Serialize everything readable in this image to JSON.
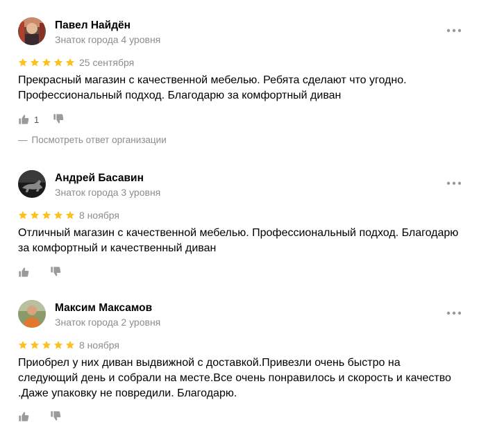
{
  "reviews": [
    {
      "author": "Павел Найдён",
      "level": "Знаток города 4 уровня",
      "rating": 5,
      "date": "25 сентября",
      "text": "Прекрасный магазин с качественной мебелью. Ребята сделают что угодно. Профессиональный подход. Благодарю за комфортный диван",
      "likes": "1",
      "org_answer_link": "Посмотреть ответ организации",
      "avatar_icon": "avatar-photo-icon"
    },
    {
      "author": "Андрей Басавин",
      "level": "Знаток города 3 уровня",
      "rating": 5,
      "date": "8 ноября",
      "text": "Отличный магазин с качественной мебелью. Профессиональный подход. Благодарю за комфортный и качественный диван",
      "likes": "",
      "avatar_icon": "avatar-animal-icon"
    },
    {
      "author": "Максим Максамов",
      "level": "Знаток города 2 уровня",
      "rating": 5,
      "date": "8 ноября",
      "text": "Приобрел у них диван выдвижной с доставкой.Привезли очень быстро на следующий день и собрали на месте.Все очень понравилось и скорость и качество .Даже упаковку не повредили. Благодарю.",
      "likes": "",
      "avatar_icon": "avatar-photo-icon"
    }
  ],
  "colors": {
    "star": "#fcc11f",
    "secondary_text": "#8c8c8c",
    "icon": "#9a9a9a"
  },
  "icons": {
    "more": "more-dots-icon",
    "like": "thumb-up-icon",
    "dislike": "thumb-down-icon",
    "star": "star-icon"
  }
}
